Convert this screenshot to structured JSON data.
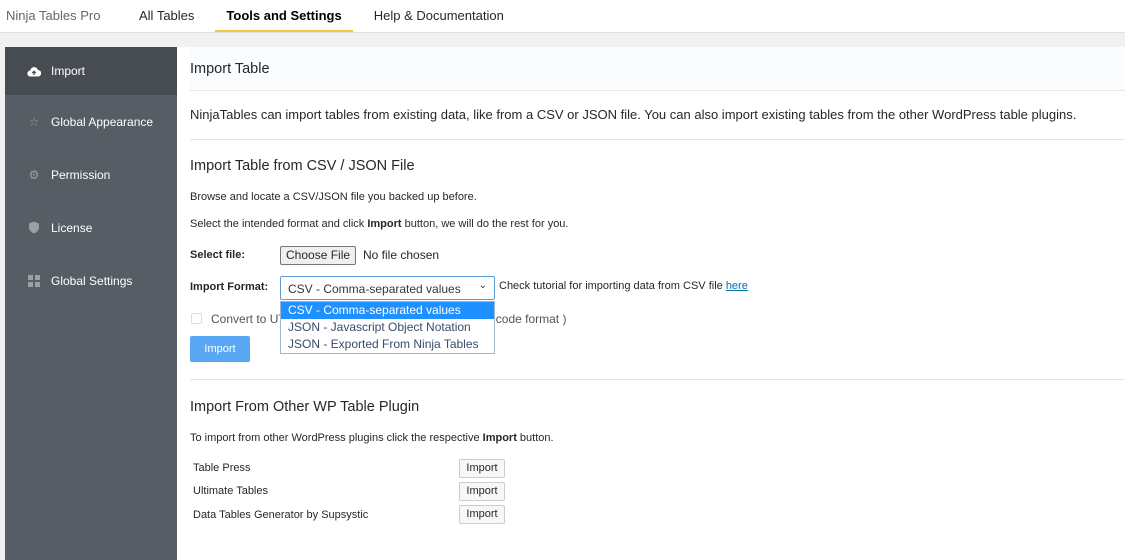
{
  "topbar": {
    "brand": "Ninja Tables Pro",
    "tabs": [
      {
        "label": "All Tables"
      },
      {
        "label": "Tools and Settings"
      },
      {
        "label": "Help & Documentation"
      }
    ]
  },
  "sidebar": {
    "items": [
      {
        "label": "Import",
        "icon": "cloud-upload-icon"
      },
      {
        "label": "Global Appearance",
        "icon": "star-icon"
      },
      {
        "label": "Permission",
        "icon": "gear-icon"
      },
      {
        "label": "License",
        "icon": "shield-icon"
      },
      {
        "label": "Global Settings",
        "icon": "grid-icon"
      }
    ]
  },
  "main": {
    "title": "Import Table",
    "description": "NinjaTables can import tables from existing data, like from a CSV or JSON file. You can also import existing tables from the other WordPress table plugins.",
    "csv": {
      "heading": "Import Table from CSV / JSON File",
      "line1": "Browse and locate a CSV/JSON file you backed up before.",
      "line2_pre": "Select the intended format and click ",
      "line2_bold": "Import",
      "line2_post": " button, we will do the rest for you.",
      "select_file_label": "Select file:",
      "choose_file": "Choose File",
      "no_file": "No file chosen",
      "format_label": "Import Format:",
      "format_value": "CSV - Comma-separated values",
      "format_options": [
        "CSV - Comma-separated values",
        "JSON - Javascript Object Notation",
        "JSON - Exported From Ninja Tables"
      ],
      "tutorial_text": "Check tutorial for importing data from CSV file ",
      "tutorial_link": "here",
      "convert_label": "Convert to UTF-8 (Check if your CSV file is in non-unicode format )",
      "import_button": "Import"
    },
    "other": {
      "heading": "Import From Other WP Table Plugin",
      "desc_pre": "To import from other WordPress plugins click the respective ",
      "desc_bold": "Import",
      "desc_post": " button.",
      "plugins": [
        {
          "name": "Table Press",
          "button": "Import"
        },
        {
          "name": "Ultimate Tables",
          "button": "Import"
        },
        {
          "name": "Data Tables Generator by Supsystic",
          "button": "Import"
        }
      ]
    }
  }
}
